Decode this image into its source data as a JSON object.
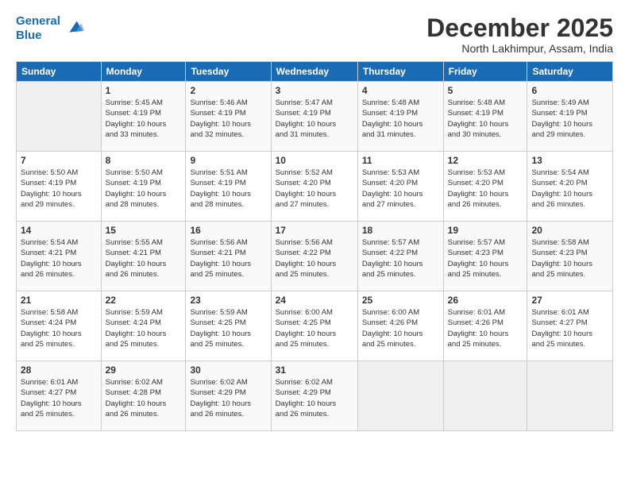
{
  "header": {
    "logo_line1": "General",
    "logo_line2": "Blue",
    "month_title": "December 2025",
    "location": "North Lakhimpur, Assam, India"
  },
  "weekdays": [
    "Sunday",
    "Monday",
    "Tuesday",
    "Wednesday",
    "Thursday",
    "Friday",
    "Saturday"
  ],
  "weeks": [
    [
      {
        "day": "",
        "info": ""
      },
      {
        "day": "1",
        "info": "Sunrise: 5:45 AM\nSunset: 4:19 PM\nDaylight: 10 hours\nand 33 minutes."
      },
      {
        "day": "2",
        "info": "Sunrise: 5:46 AM\nSunset: 4:19 PM\nDaylight: 10 hours\nand 32 minutes."
      },
      {
        "day": "3",
        "info": "Sunrise: 5:47 AM\nSunset: 4:19 PM\nDaylight: 10 hours\nand 31 minutes."
      },
      {
        "day": "4",
        "info": "Sunrise: 5:48 AM\nSunset: 4:19 PM\nDaylight: 10 hours\nand 31 minutes."
      },
      {
        "day": "5",
        "info": "Sunrise: 5:48 AM\nSunset: 4:19 PM\nDaylight: 10 hours\nand 30 minutes."
      },
      {
        "day": "6",
        "info": "Sunrise: 5:49 AM\nSunset: 4:19 PM\nDaylight: 10 hours\nand 29 minutes."
      }
    ],
    [
      {
        "day": "7",
        "info": "Sunrise: 5:50 AM\nSunset: 4:19 PM\nDaylight: 10 hours\nand 29 minutes."
      },
      {
        "day": "8",
        "info": "Sunrise: 5:50 AM\nSunset: 4:19 PM\nDaylight: 10 hours\nand 28 minutes."
      },
      {
        "day": "9",
        "info": "Sunrise: 5:51 AM\nSunset: 4:19 PM\nDaylight: 10 hours\nand 28 minutes."
      },
      {
        "day": "10",
        "info": "Sunrise: 5:52 AM\nSunset: 4:20 PM\nDaylight: 10 hours\nand 27 minutes."
      },
      {
        "day": "11",
        "info": "Sunrise: 5:53 AM\nSunset: 4:20 PM\nDaylight: 10 hours\nand 27 minutes."
      },
      {
        "day": "12",
        "info": "Sunrise: 5:53 AM\nSunset: 4:20 PM\nDaylight: 10 hours\nand 26 minutes."
      },
      {
        "day": "13",
        "info": "Sunrise: 5:54 AM\nSunset: 4:20 PM\nDaylight: 10 hours\nand 26 minutes."
      }
    ],
    [
      {
        "day": "14",
        "info": "Sunrise: 5:54 AM\nSunset: 4:21 PM\nDaylight: 10 hours\nand 26 minutes."
      },
      {
        "day": "15",
        "info": "Sunrise: 5:55 AM\nSunset: 4:21 PM\nDaylight: 10 hours\nand 26 minutes."
      },
      {
        "day": "16",
        "info": "Sunrise: 5:56 AM\nSunset: 4:21 PM\nDaylight: 10 hours\nand 25 minutes."
      },
      {
        "day": "17",
        "info": "Sunrise: 5:56 AM\nSunset: 4:22 PM\nDaylight: 10 hours\nand 25 minutes."
      },
      {
        "day": "18",
        "info": "Sunrise: 5:57 AM\nSunset: 4:22 PM\nDaylight: 10 hours\nand 25 minutes."
      },
      {
        "day": "19",
        "info": "Sunrise: 5:57 AM\nSunset: 4:23 PM\nDaylight: 10 hours\nand 25 minutes."
      },
      {
        "day": "20",
        "info": "Sunrise: 5:58 AM\nSunset: 4:23 PM\nDaylight: 10 hours\nand 25 minutes."
      }
    ],
    [
      {
        "day": "21",
        "info": "Sunrise: 5:58 AM\nSunset: 4:24 PM\nDaylight: 10 hours\nand 25 minutes."
      },
      {
        "day": "22",
        "info": "Sunrise: 5:59 AM\nSunset: 4:24 PM\nDaylight: 10 hours\nand 25 minutes."
      },
      {
        "day": "23",
        "info": "Sunrise: 5:59 AM\nSunset: 4:25 PM\nDaylight: 10 hours\nand 25 minutes."
      },
      {
        "day": "24",
        "info": "Sunrise: 6:00 AM\nSunset: 4:25 PM\nDaylight: 10 hours\nand 25 minutes."
      },
      {
        "day": "25",
        "info": "Sunrise: 6:00 AM\nSunset: 4:26 PM\nDaylight: 10 hours\nand 25 minutes."
      },
      {
        "day": "26",
        "info": "Sunrise: 6:01 AM\nSunset: 4:26 PM\nDaylight: 10 hours\nand 25 minutes."
      },
      {
        "day": "27",
        "info": "Sunrise: 6:01 AM\nSunset: 4:27 PM\nDaylight: 10 hours\nand 25 minutes."
      }
    ],
    [
      {
        "day": "28",
        "info": "Sunrise: 6:01 AM\nSunset: 4:27 PM\nDaylight: 10 hours\nand 25 minutes."
      },
      {
        "day": "29",
        "info": "Sunrise: 6:02 AM\nSunset: 4:28 PM\nDaylight: 10 hours\nand 26 minutes."
      },
      {
        "day": "30",
        "info": "Sunrise: 6:02 AM\nSunset: 4:29 PM\nDaylight: 10 hours\nand 26 minutes."
      },
      {
        "day": "31",
        "info": "Sunrise: 6:02 AM\nSunset: 4:29 PM\nDaylight: 10 hours\nand 26 minutes."
      },
      {
        "day": "",
        "info": ""
      },
      {
        "day": "",
        "info": ""
      },
      {
        "day": "",
        "info": ""
      }
    ]
  ]
}
